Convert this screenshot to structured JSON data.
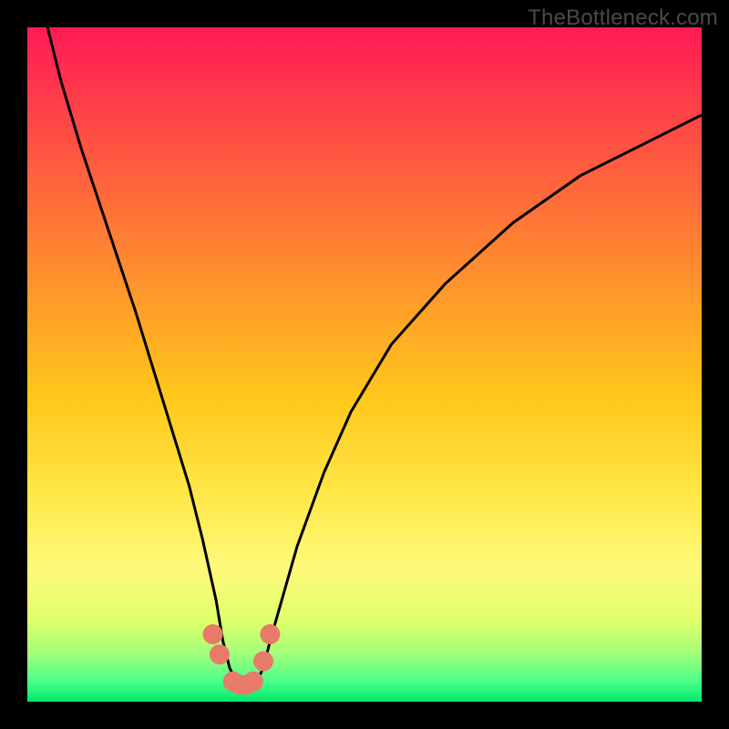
{
  "watermark": "TheBottleneck.com",
  "chart_data": {
    "type": "line",
    "title": "",
    "xlabel": "",
    "ylabel": "",
    "xlim": [
      0,
      100
    ],
    "ylim": [
      0,
      100
    ],
    "series": [
      {
        "name": "bottleneck-curve",
        "x": [
          3,
          5,
          8,
          12,
          16,
          20,
          24,
          26,
          28,
          29,
          30,
          31,
          32,
          33,
          34,
          35,
          36,
          38,
          40,
          44,
          48,
          54,
          62,
          72,
          82,
          92,
          100
        ],
        "values": [
          100,
          92,
          82,
          70,
          58,
          45,
          32,
          24,
          15,
          9,
          5,
          3,
          2,
          2,
          3,
          5,
          9,
          16,
          23,
          34,
          43,
          53,
          62,
          71,
          78,
          83,
          87
        ]
      },
      {
        "name": "accent-dots",
        "x": [
          27.5,
          28.5,
          30.5,
          31.5,
          32.5,
          33.5,
          35,
          36
        ],
        "values": [
          10,
          7,
          3,
          2.5,
          2.5,
          3,
          6,
          10
        ]
      }
    ],
    "gradient_stops": [
      {
        "pos": 0,
        "color": "#ff1a55"
      },
      {
        "pos": 25,
        "color": "#ff6a3a"
      },
      {
        "pos": 55,
        "color": "#ffc81a"
      },
      {
        "pos": 80,
        "color": "#fff97a"
      },
      {
        "pos": 100,
        "color": "#00e86a"
      }
    ]
  }
}
